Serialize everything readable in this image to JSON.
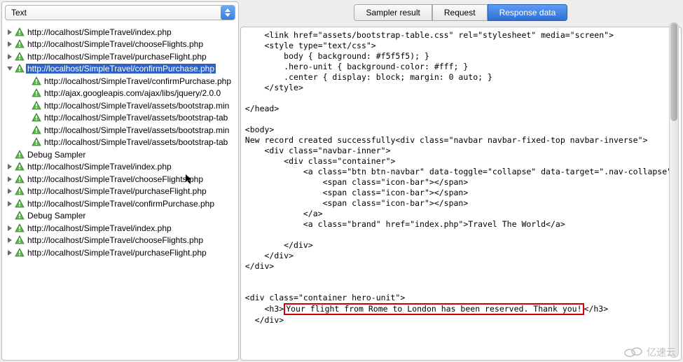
{
  "dropdown": {
    "selected": "Text"
  },
  "tree": [
    {
      "depth": 0,
      "disclosure": "right",
      "kind": "sampler",
      "text": "http://localhost/SimpleTravel/index.php"
    },
    {
      "depth": 0,
      "disclosure": "right",
      "kind": "sampler",
      "text": "http://localhost/SimpleTravel/chooseFlights.php"
    },
    {
      "depth": 0,
      "disclosure": "right",
      "kind": "sampler",
      "text": "http://localhost/SimpleTravel/purchaseFlight.php"
    },
    {
      "depth": 0,
      "disclosure": "down",
      "kind": "sampler",
      "text": "http://localhost/SimpleTravel/confirmPurchase.php",
      "selected": true
    },
    {
      "depth": 1,
      "disclosure": "none",
      "kind": "sampler",
      "text": "http://localhost/SimpleTravel/confirmPurchase.php"
    },
    {
      "depth": 1,
      "disclosure": "none",
      "kind": "sampler",
      "text": "http://ajax.googleapis.com/ajax/libs/jquery/2.0.0"
    },
    {
      "depth": 1,
      "disclosure": "none",
      "kind": "sampler",
      "text": "http://localhost/SimpleTravel/assets/bootstrap.min"
    },
    {
      "depth": 1,
      "disclosure": "none",
      "kind": "sampler",
      "text": "http://localhost/SimpleTravel/assets/bootstrap-tab"
    },
    {
      "depth": 1,
      "disclosure": "none",
      "kind": "sampler",
      "text": "http://localhost/SimpleTravel/assets/bootstrap.min"
    },
    {
      "depth": 1,
      "disclosure": "none",
      "kind": "sampler",
      "text": "http://localhost/SimpleTravel/assets/bootstrap-tab"
    },
    {
      "depth": 0,
      "disclosure": "none",
      "kind": "sampler",
      "text": "Debug Sampler"
    },
    {
      "depth": 0,
      "disclosure": "right",
      "kind": "sampler",
      "text": "http://localhost/SimpleTravel/index.php"
    },
    {
      "depth": 0,
      "disclosure": "right",
      "kind": "sampler",
      "text": "http://localhost/SimpleTravel/chooseFlights.php",
      "cursor": true
    },
    {
      "depth": 0,
      "disclosure": "right",
      "kind": "sampler",
      "text": "http://localhost/SimpleTravel/purchaseFlight.php"
    },
    {
      "depth": 0,
      "disclosure": "right",
      "kind": "sampler",
      "text": "http://localhost/SimpleTravel/confirmPurchase.php"
    },
    {
      "depth": 0,
      "disclosure": "none",
      "kind": "sampler",
      "text": "Debug Sampler"
    },
    {
      "depth": 0,
      "disclosure": "right",
      "kind": "sampler",
      "text": "http://localhost/SimpleTravel/index.php"
    },
    {
      "depth": 0,
      "disclosure": "right",
      "kind": "sampler",
      "text": "http://localhost/SimpleTravel/chooseFlights.php"
    },
    {
      "depth": 0,
      "disclosure": "right",
      "kind": "sampler",
      "text": "http://localhost/SimpleTravel/purchaseFlight.php"
    }
  ],
  "tabs": [
    {
      "label": "Sampler result",
      "active": false
    },
    {
      "label": "Request",
      "active": false
    },
    {
      "label": "Response data",
      "active": true
    }
  ],
  "response": {
    "line1": "    <link href=\"assets/bootstrap-table.css\" rel=\"stylesheet\" media=\"screen\">",
    "line2": "    <style type=\"text/css\">",
    "line3": "        body { background: #f5f5f5); }",
    "line4": "        .hero-unit { background-color: #fff; }",
    "line5": "        .center { display: block; margin: 0 auto; }",
    "line6": "    </style>",
    "line7": "",
    "line8": "</head>",
    "line9": "",
    "line10": "<body>",
    "line11": "New record created successfully<div class=\"navbar navbar-fixed-top navbar-inverse\">",
    "line12": "    <div class=\"navbar-inner\">",
    "line13": "        <div class=\"container\">",
    "line14": "            <a class=\"btn btn-navbar\" data-toggle=\"collapse\" data-target=\".nav-collapse\">",
    "line15": "                <span class=\"icon-bar\"></span>",
    "line16": "                <span class=\"icon-bar\"></span>",
    "line17": "                <span class=\"icon-bar\"></span>",
    "line18": "            </a>",
    "line19": "            <a class=\"brand\" href=\"index.php\">Travel The World</a>",
    "line20": "",
    "line21": "        </div>",
    "line22": "    </div>",
    "line23": "</div>",
    "line24": "",
    "line25": "",
    "line26": "<div class=\"container hero-unit\">",
    "line27a": "    <h3>",
    "line27b": "Your flight from Rome to London has been reserved. Thank you!",
    "line27c": "</h3>",
    "line28": "  </div>"
  },
  "watermark": "亿速云"
}
